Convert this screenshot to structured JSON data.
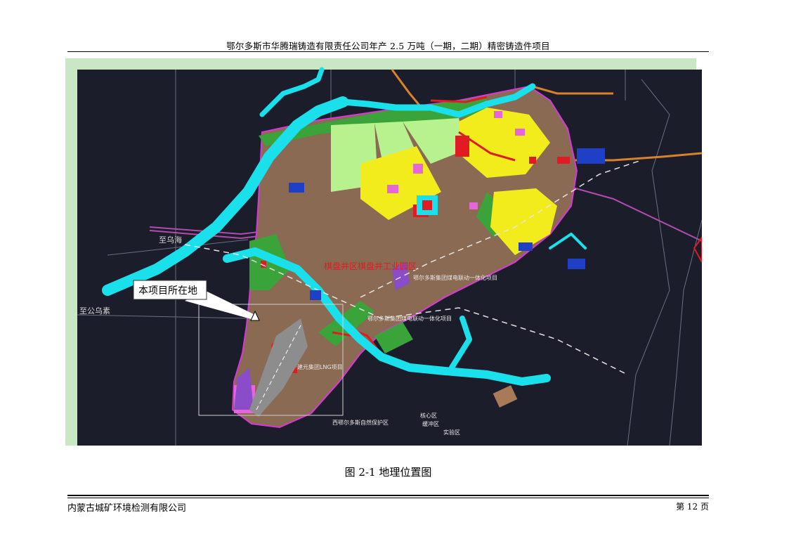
{
  "header": {
    "title": "鄂尔多斯市华腾瑞铸造有限责任公司年产 2.5 万吨（一期，二期）精密铸造件项目"
  },
  "map": {
    "callout_label": "本项目所在地",
    "place_labels": {
      "to_wuhai": "至乌海",
      "to_gongwusu": "至公乌素",
      "district_red": "棋盘井区棋盘井工业园区",
      "power_plant_1": "鄂尔多斯集团煤电联动一体化项目",
      "power_plant_2": "鄂尔多斯集团煤电联动一体化项目",
      "lng_project": "建元集团LNG项目",
      "protection_zone": "西鄂尔多斯自然保护区",
      "core_zone": "核心区",
      "buffer_zone": "缓冲区",
      "experiment_zone": "实验区"
    },
    "colors": {
      "background": "#1c1d2b",
      "river": "#19e0ea",
      "brown_zone": "#8a6a52",
      "green_zone": "#3aa33a",
      "yellow_zone": "#f2ec1d",
      "light_green": "#b8f28f",
      "magenta": "#d63ad6",
      "red": "#e01b24",
      "border_green": "#c7e8c2"
    }
  },
  "caption": "图 2-1 地理位置图",
  "footer": {
    "company": "内蒙古城矿环境检测有限公司",
    "page": "第 12 页"
  }
}
